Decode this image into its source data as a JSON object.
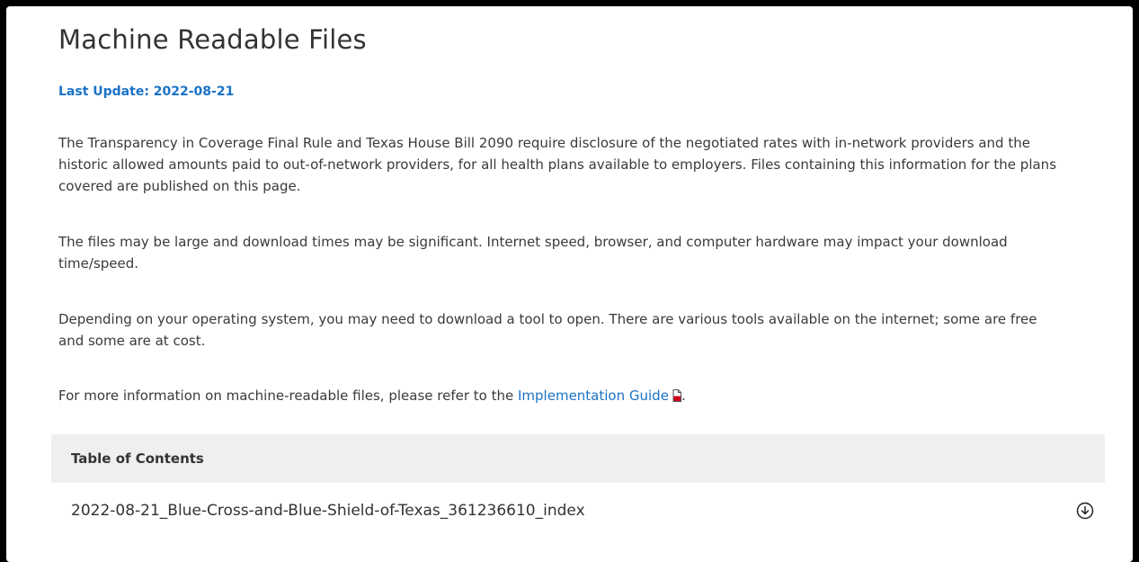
{
  "page": {
    "title": "Machine Readable Files",
    "last_update": "Last Update: 2022-08-21",
    "paragraph1": "The Transparency in Coverage Final Rule and Texas House Bill 2090 require disclosure of the negotiated rates with in-network providers and the historic allowed amounts paid to out-of-network providers, for all health plans available to employers.  Files containing this information for the plans covered are published on this page.",
    "paragraph2": "The files may be large and download times may be significant. Internet speed, browser, and computer hardware may impact your download time/speed.",
    "paragraph3": "Depending on your operating system, you may need to download a tool to open.  There are various tools available on the internet; some are free and some are at cost.",
    "paragraph4_prefix": "For more information on machine-readable files, please refer to the ",
    "paragraph4_link": "Implementation Guide",
    "paragraph4_suffix": "."
  },
  "toc": {
    "header": "Table of Contents",
    "files": [
      {
        "name": "2022-08-21_Blue-Cross-and-Blue-Shield-of-Texas_361236610_index",
        "icon": "download-circle-icon"
      }
    ]
  },
  "colors": {
    "link": "#1a73c7",
    "toc_header_bg": "#efefef",
    "pdf_icon": "#d0021b"
  }
}
